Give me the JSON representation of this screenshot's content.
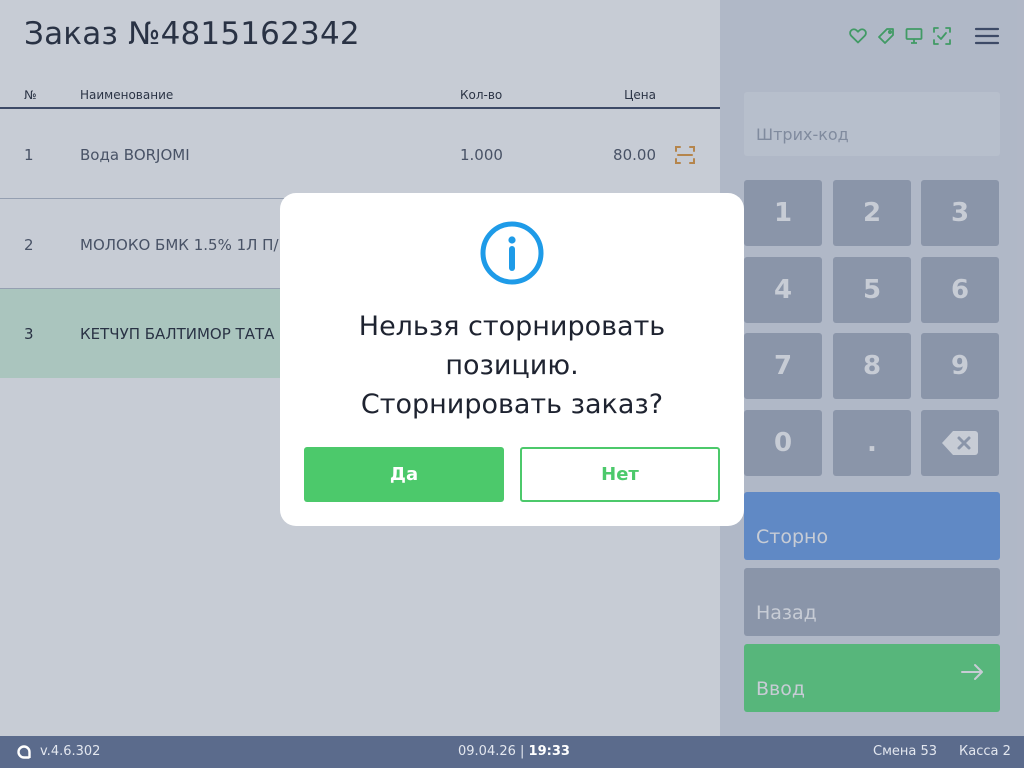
{
  "order": {
    "title": "Заказ №4815162342"
  },
  "table": {
    "headers": {
      "num": "№",
      "name": "Наименование",
      "qty": "Кол-во",
      "price": "Цена"
    },
    "rows": [
      {
        "num": "1",
        "name": "Вода BORJOMI",
        "qty": "1.000",
        "price": "80.00"
      },
      {
        "num": "2",
        "name": "МОЛОКО БМК 1.5% 1Л П/",
        "qty": "",
        "price": ""
      },
      {
        "num": "3",
        "name": "КЕТЧУП БАЛТИМОР ТАТА",
        "qty": "",
        "price": ""
      }
    ]
  },
  "header_icons": [
    "heart-icon",
    "tag-icon",
    "monitor-icon",
    "checkbox-icon",
    "menu-icon"
  ],
  "barcode": {
    "placeholder": "Штрих-код"
  },
  "keypad": {
    "keys": [
      "1",
      "2",
      "3",
      "4",
      "5",
      "6",
      "7",
      "8",
      "9",
      "0",
      "."
    ]
  },
  "actions": {
    "storno": "Сторно",
    "back": "Назад",
    "enter": "Ввод"
  },
  "footer": {
    "version": "v.4.6.302",
    "date": "09.04.26 | ",
    "time": "19:33",
    "shift": "Смена 53",
    "kassa": "Касса 2"
  },
  "dialog": {
    "lines": [
      "Нельзя сторнировать",
      "позицию.",
      "Сторнировать заказ?"
    ],
    "yes": "Да",
    "no": "Нет"
  },
  "colors": {
    "accent_green": "#4cc96b",
    "storno_blue": "#6c9fe8",
    "footer": "#5b6b8c",
    "info_blue": "#1e9be8",
    "scan_orange": "#e59a3c"
  }
}
